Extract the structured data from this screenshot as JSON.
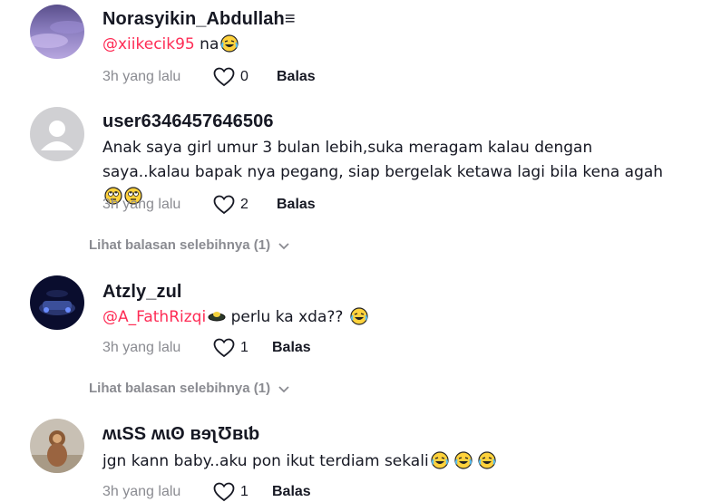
{
  "comments": [
    {
      "username": "Norasyikin_Abdullah≡",
      "mention": "@xiikecik95",
      "text": " na",
      "emojis": [
        "laugh"
      ],
      "time": "3h yang lalu",
      "likes": "0",
      "reply_label": "Balas"
    },
    {
      "username": "user6346457646506",
      "mention": "",
      "text": "Anak saya girl umur 3 bulan lebih,suka meragam kalau dengan saya..kalau bapak nya pegang, siap bergelak ketawa lagi bila kena agah",
      "emojis": [
        "rolling-eyes",
        "rolling-eyes"
      ],
      "time": "3h yang lalu",
      "likes": "2",
      "reply_label": "Balas",
      "view_more": "Lihat balasan selebihnya (1)"
    },
    {
      "username": "Atzly_zul",
      "mention": "@A_FathRizqi",
      "text": " perlu ka xda??",
      "emojis": [
        "laugh"
      ],
      "time": "3h yang lalu",
      "likes": "1",
      "reply_label": "Balas",
      "view_more": "Lihat balasan selebihnya (1)"
    },
    {
      "username": "ʍɩSS ʍɩʘ ʙɘʅƱʙɩƅ",
      "mention": "",
      "text": "jgn kann baby..aku pon ikut terdiam sekali",
      "emojis": [
        "laugh",
        "laugh",
        "laugh"
      ],
      "time": "3h yang lalu",
      "likes": "1",
      "reply_label": "Balas"
    }
  ],
  "colors": {
    "mention": "#fe2c55",
    "muted": "#8a8b91",
    "text": "#161823"
  },
  "icons": {
    "like": "heart-outline-icon",
    "expand": "chevron-down-icon",
    "emoji_laugh": "laughing-tears-emoji",
    "emoji_rolling": "rolling-eyes-emoji"
  }
}
